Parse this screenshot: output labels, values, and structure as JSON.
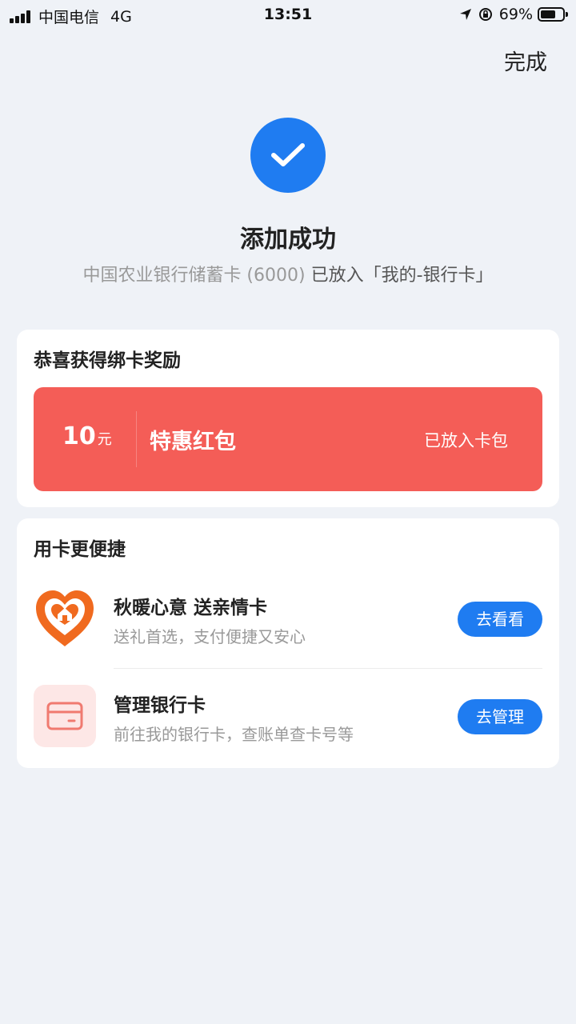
{
  "status_bar": {
    "carrier": "中国电信",
    "network": "4G",
    "time": "13:51",
    "battery": "69%",
    "battery_level": 0.69
  },
  "header": {
    "done_label": "完成"
  },
  "success": {
    "title": "添加成功",
    "subtitle_grey": "中国农业银行储蓄卡 (6000)",
    "subtitle_dark": "已放入「我的-银行卡」"
  },
  "reward": {
    "title": "恭喜获得绑卡奖励",
    "coupon": {
      "amount": "10",
      "unit": "元",
      "name": "特惠红包",
      "status": "已放入卡包"
    }
  },
  "quick": {
    "title": "用卡更便捷",
    "items": [
      {
        "title": "秋暖心意 送亲情卡",
        "desc": "送礼首选，支付便捷又安心",
        "button": "去看看",
        "icon": "heart-house-icon"
      },
      {
        "title": "管理银行卡",
        "desc": "前往我的银行卡，查账单查卡号等",
        "button": "去管理",
        "icon": "bank-card-icon"
      }
    ]
  },
  "colors": {
    "accent": "#1f7cf1",
    "coupon": "#f45d57",
    "background": "#eff2f7"
  }
}
